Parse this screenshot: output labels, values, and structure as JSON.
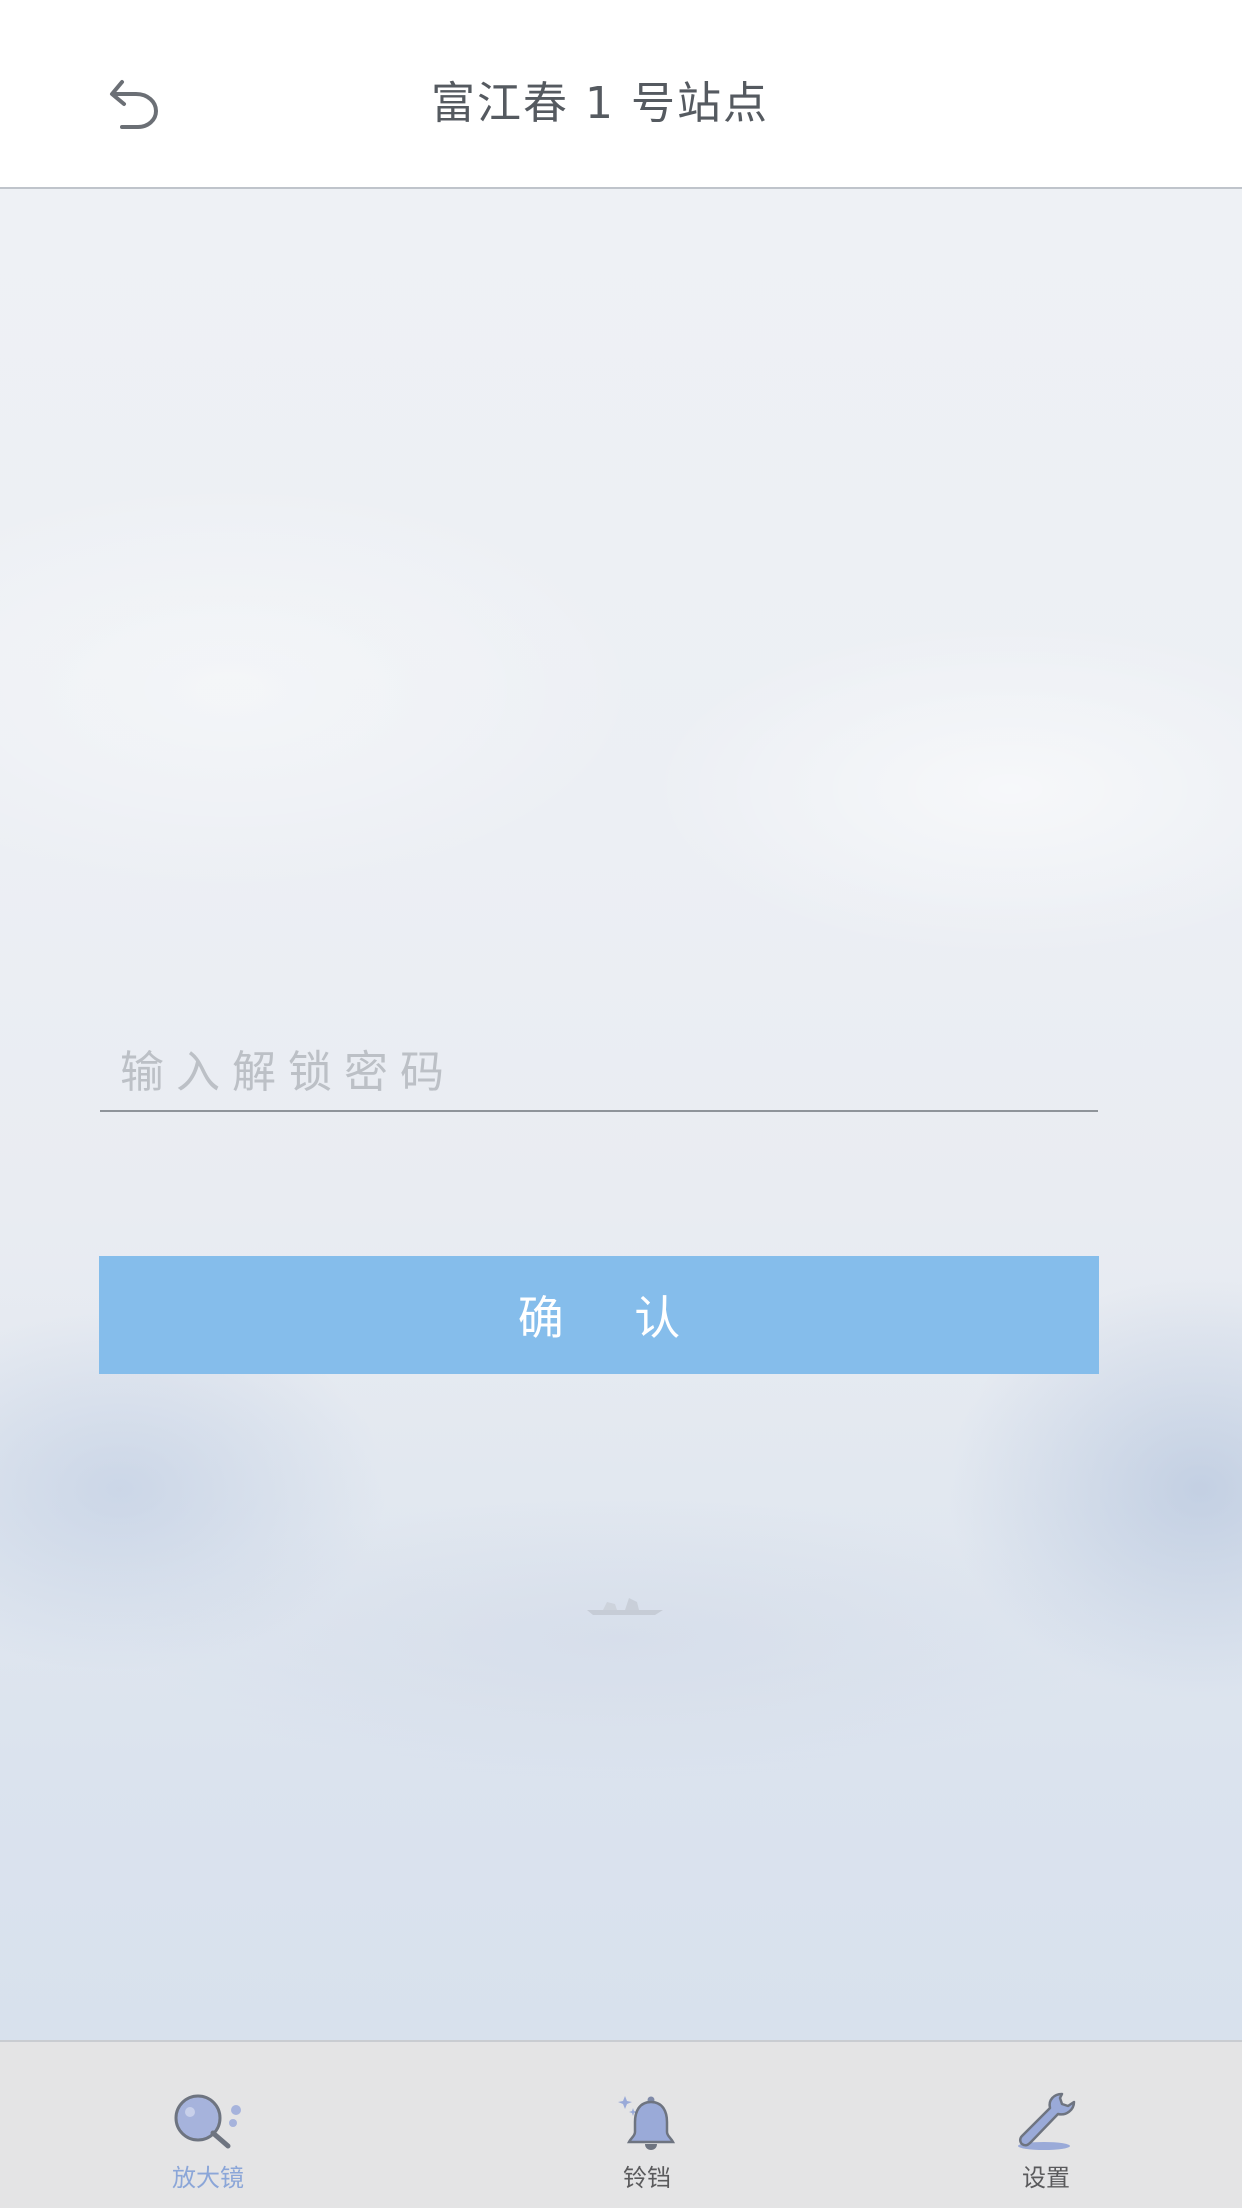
{
  "header": {
    "title": "富江春 1 号站点",
    "back_icon": "undo-arrow-icon"
  },
  "form": {
    "password_placeholder": "输入解锁密码",
    "password_value": "",
    "confirm_label": "确 认"
  },
  "tabbar": {
    "active_tab": "magnifier",
    "tabs": [
      {
        "id": "magnifier",
        "label": "放大镜",
        "icon": "magnifier-icon"
      },
      {
        "id": "bell",
        "label": "铃铛",
        "icon": "bell-icon"
      },
      {
        "id": "settings",
        "label": "设置",
        "icon": "wrench-icon"
      }
    ]
  },
  "colors": {
    "accent": "#85bdeb",
    "active_tab": "#8ba6d8",
    "icon_fill": "#9aaad8",
    "title_text": "#555a60",
    "tabbar_bg": "#e4e4e5"
  }
}
